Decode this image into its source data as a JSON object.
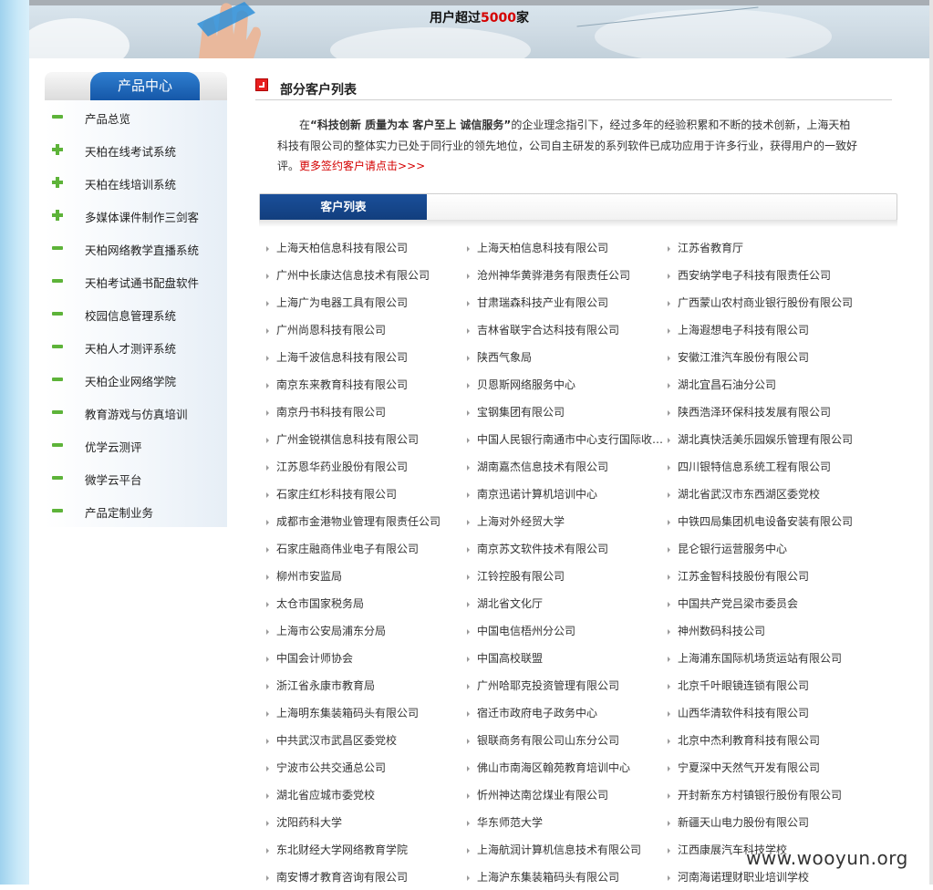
{
  "banner": {
    "title_prefix": "用户超过",
    "title_number": "5000",
    "title_suffix": "家"
  },
  "sidebar": {
    "title": "产品中心",
    "items": [
      {
        "label": "产品总览",
        "icon": "minus-icon"
      },
      {
        "label": "天柏在线考试系统",
        "icon": "plus-icon"
      },
      {
        "label": "天柏在线培训系统",
        "icon": "plus-icon"
      },
      {
        "label": "多媒体课件制作三剑客",
        "icon": "plus-icon"
      },
      {
        "label": "天柏网络教学直播系统",
        "icon": "minus-icon"
      },
      {
        "label": "天柏考试通书配盘软件",
        "icon": "minus-icon"
      },
      {
        "label": "校园信息管理系统",
        "icon": "minus-icon"
      },
      {
        "label": "天柏人才测评系统",
        "icon": "minus-icon"
      },
      {
        "label": "天柏企业网络学院",
        "icon": "minus-icon"
      },
      {
        "label": "教育游戏与仿真培训",
        "icon": "minus-icon"
      },
      {
        "label": "优学云测评",
        "icon": "minus-icon"
      },
      {
        "label": "微学云平台",
        "icon": "minus-icon"
      },
      {
        "label": "产品定制业务",
        "icon": "minus-icon"
      }
    ]
  },
  "main": {
    "section_title": "部分客户列表",
    "intro_p1": "在",
    "intro_bold": "“科技创新 质量为本 客户至上 诚信服务”",
    "intro_p2": "的企业理念指引下，经过多年的经验积累和不断的技术创新，上海天柏科技有限公司的整体实力已处于同行业的领先地位，公司自主研发的系列软件已成功应用于许多行业，获得用户的一致好评。",
    "intro_link": "更多签约客户请点击>>>",
    "list_tab": "客户列表",
    "clients": [
      [
        "上海天柏信息科技有限公司",
        "上海天柏信息科技有限公司",
        "江苏省教育厅"
      ],
      [
        "广州中长康达信息技术有限公司",
        "沧州神华黄骅港务有限责任公司",
        "西安纳学电子科技有限责任公司"
      ],
      [
        "上海广为电器工具有限公司",
        "甘肃瑞森科技产业有限公司",
        "广西蒙山农村商业银行股份有限公司"
      ],
      [
        "广州尚恩科技有限公司",
        "吉林省联宇合达科技有限公司",
        "上海遐想电子科技有限公司"
      ],
      [
        "上海千波信息科技有限公司",
        "陕西气象局",
        "安徽江淮汽车股份有限公司"
      ],
      [
        "南京东来教育科技有限公司",
        "贝恩斯网络服务中心",
        "湖北宜昌石油分公司"
      ],
      [
        "南京丹书科技有限公司",
        "宝钢集团有限公司",
        "陕西浩泽环保科技发展有限公司"
      ],
      [
        "广州金锐祺信息科技有限公司",
        "中国人民银行南通市中心支行国际收…",
        "湖北真快活美乐园娱乐管理有限公司"
      ],
      [
        "江苏恩华药业股份有限公司",
        "湖南嘉杰信息技术有限公司",
        "四川银特信息系统工程有限公司"
      ],
      [
        "石家庄红杉科技有限公司",
        "南京迅诺计算机培训中心",
        "湖北省武汉市东西湖区委党校"
      ],
      [
        "成都市金港物业管理有限责任公司",
        "上海对外经贸大学",
        "中铁四局集团机电设备安装有限公司"
      ],
      [
        "石家庄融商伟业电子有限公司",
        "南京苏文软件技术有限公司",
        "昆仑银行运营服务中心"
      ],
      [
        "柳州市安监局",
        "江铃控股有限公司",
        "江苏金智科技股份有限公司"
      ],
      [
        "太仓市国家税务局",
        "湖北省文化厅",
        "中国共产党吕梁市委员会"
      ],
      [
        "上海市公安局浦东分局",
        "中国电信梧州分公司",
        "神州数码科技公司"
      ],
      [
        "中国会计师协会",
        "中国高校联盟",
        "上海浦东国际机场货运站有限公司"
      ],
      [
        "浙江省永康市教育局",
        "广州哈耶克投资管理有限公司",
        "北京千叶眼镜连锁有限公司"
      ],
      [
        "上海明东集装箱码头有限公司",
        "宿迁市政府电子政务中心",
        "山西华清软件科技有限公司"
      ],
      [
        "中共武汉市武昌区委党校",
        "银联商务有限公司山东分公司",
        "北京中杰利教育科技有限公司"
      ],
      [
        "宁波市公共交通总公司",
        "佛山市南海区翰苑教育培训中心",
        "宁夏深中天然气开发有限公司"
      ],
      [
        "湖北省应城市委党校",
        "忻州神达南岔煤业有限公司",
        "开封新东方村镇银行股份有限公司"
      ],
      [
        "沈阳药科大学",
        "华东师范大学",
        "新疆天山电力股份有限公司"
      ],
      [
        "东北财经大学网络教育学院",
        "上海航润计算机信息技术有限公司",
        "江西康展汽车科技学校"
      ],
      [
        "南安博才教育咨询有限公司",
        "上海沪东集装箱码头有限公司",
        "河南海诺理财职业培训学校"
      ]
    ]
  },
  "watermark": "www.wooyun.org",
  "colors": {
    "accent_red": "#d40000",
    "tab_blue": "#1a4f9a",
    "icon_green": "#5db339"
  }
}
